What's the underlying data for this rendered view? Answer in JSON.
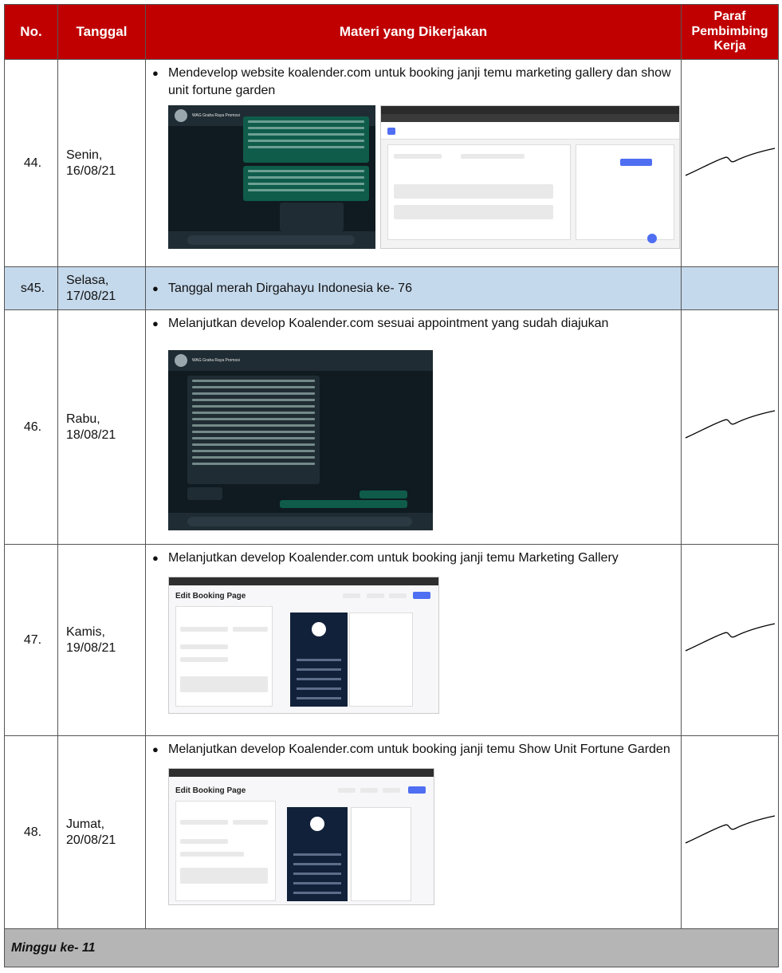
{
  "header": {
    "no": "No.",
    "date": "Tanggal",
    "material": "Materi yang Dikerjakan",
    "sign_line1": "Paraf",
    "sign_line2": "Pembimbing",
    "sign_line3": "Kerja"
  },
  "rows": [
    {
      "no": "44.",
      "day": "Senin,",
      "date": "16/08/21",
      "text": "Mendevelop website koalender.com untuk booking janji temu marketing gallery dan show unit fortune garden"
    },
    {
      "no": "s45.",
      "day": "Selasa,",
      "date": "17/08/21",
      "text": "Tanggal merah Dirgahayu Indonesia ke- 76"
    },
    {
      "no": "46.",
      "day": "Rabu,",
      "date": "18/08/21",
      "text": "Melanjutkan develop Koalender.com sesuai appointment yang sudah diajukan"
    },
    {
      "no": "47.",
      "day": "Kamis,",
      "date": "19/08/21",
      "text": "Melanjutkan develop Koalender.com untuk booking janji temu Marketing Gallery"
    },
    {
      "no": "48.",
      "day": "Jumat,",
      "date": "20/08/21",
      "text": "Melanjutkan develop Koalender.com untuk booking janji temu Show Unit Fortune Garden"
    }
  ],
  "screens": {
    "wa_group": "WAG Graha Raya Promosi",
    "edit_title": "Edit Booking Page"
  },
  "footer": {
    "week_label": "Minggu ke- 11"
  }
}
